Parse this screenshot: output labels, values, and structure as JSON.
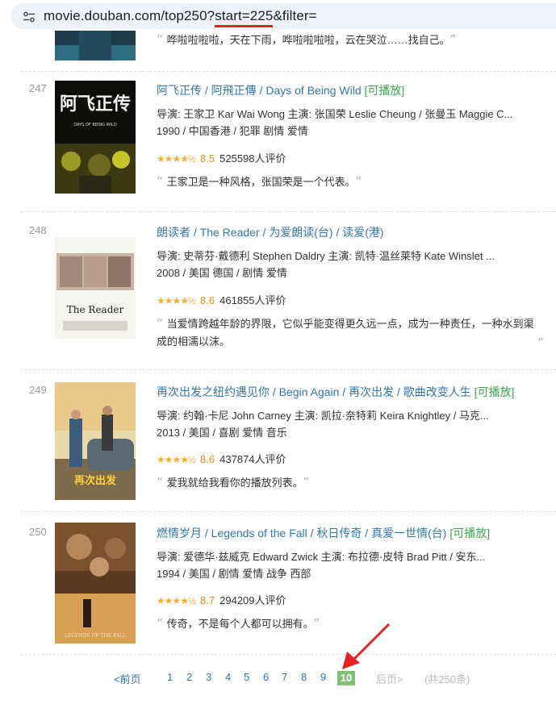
{
  "browser": {
    "url_prefix": "movie.douban.com/top250?",
    "url_highlight": "start=225",
    "url_suffix": "&filter="
  },
  "top_partial": {
    "quote": "哗啦啦啦啦，天在下雨，哗啦啦啦啦，云在哭泣……找自己。"
  },
  "movies": [
    {
      "rank": "247",
      "title": "阿飞正传",
      "alt_titles": " / 阿飛正傳 / Days of Being Wild",
      "playable": "[可播放]",
      "info1": "导演: 王家卫 Kar Wai Wong   主演: 张国荣 Leslie Cheung / 张曼玉 Maggie C...",
      "info2": "1990 / 中国香港 / 犯罪 剧情 爱情",
      "stars": "★★★★½",
      "score": "8.5",
      "votes": "525598人评价",
      "quote": "王家卫是一种风格，张国荣是一个代表。"
    },
    {
      "rank": "248",
      "title": "朗读者",
      "alt_titles": " / The Reader / 为爱朗读(台) / 读爱(港)",
      "playable": "",
      "info1": "导演: 史蒂芬·戴德利 Stephen Daldry   主演: 凯特·温丝莱特 Kate Winslet ...",
      "info2": "2008 / 美国 德国 / 剧情 爱情",
      "stars": "★★★★½",
      "score": "8.6",
      "votes": "461855人评价",
      "quote": "当爱情跨越年龄的界限，它似乎能变得更久远一点，成为一种责任，一种水到渠成的相濡以沫。"
    },
    {
      "rank": "249",
      "title": "再次出发之纽约遇见你",
      "alt_titles": " / Begin Again / 再次出发 / 歌曲改变人生",
      "playable": "[可播放]",
      "info1": "导演: 约翰·卡尼 John Carney   主演: 凯拉·奈特莉 Keira Knightley / 马克...",
      "info2": "2013 / 美国 / 喜剧 爱情 音乐",
      "stars": "★★★★½",
      "score": "8.6",
      "votes": "437874人评价",
      "quote": "爱我就给我看你的播放列表。"
    },
    {
      "rank": "250",
      "title": "燃情岁月",
      "alt_titles": " / Legends of the Fall / 秋日传奇 / 真爱一世情(台)",
      "playable": "[可播放]",
      "info1": "导演: 爱德华·兹威克 Edward Zwick   主演: 布拉德·皮特 Brad Pitt / 安东...",
      "info2": "1994 / 美国 / 剧情 爱情 战争 西部",
      "stars": "★★★★½",
      "score": "8.7",
      "votes": "294209人评价",
      "quote": "传奇，不是每个人都可以拥有。"
    }
  ],
  "poster_text": {
    "p247_title": "阿飞正传",
    "p247_en": "DAYS OF BEING WILD",
    "p248_title": "The Reader",
    "p249_title": "再次出发"
  },
  "pager": {
    "prev": "<前页",
    "pages": [
      "1",
      "2",
      "3",
      "4",
      "5",
      "6",
      "7",
      "8",
      "9"
    ],
    "current": "10",
    "next": "后页>",
    "total": "(共250条)"
  },
  "colors": {
    "link": "#3377aa",
    "playable": "#3ba94d",
    "star": "#ffac2d",
    "current_page_bg": "#83bf73",
    "annotation_red": "#e52222"
  }
}
